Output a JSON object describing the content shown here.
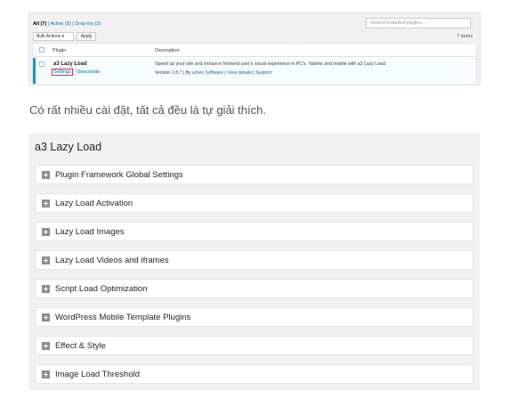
{
  "plugins_screen": {
    "filters": {
      "all": "All (7)",
      "sep1": " | ",
      "active": "Active (5)",
      "sep2": " | ",
      "dropins": "Drop-ins (2)"
    },
    "search_placeholder": "Search installed plugins...",
    "bulk_actions": "Bulk Actions ▾",
    "apply": "Apply",
    "items_count": "7 items",
    "columns": {
      "plugin": "Plugin",
      "description": "Description"
    },
    "row": {
      "name": "a3 Lazy Load",
      "settings": "Settings",
      "separator": " | ",
      "deactivate": "Deactivate",
      "description": "Speed up your site and enhance frontend user's visual experience in PC's, Tablets and mobile with a3 Lazy Load.",
      "version": "Version 1.8.7 | By ",
      "author": "a3rev Software",
      "sep": " | ",
      "view_details": "View details",
      "sep2": " | ",
      "support": "Support"
    }
  },
  "caption": "Có rất nhiều cài đặt, tất cả đều là tự giải thích.",
  "settings_screen": {
    "title": "a3 Lazy Load",
    "sections": [
      "Plugin Framework Global Settings",
      "Lazy Load Activation",
      "Lazy Load Images",
      "Lazy Load Videos and iframes",
      "Script Load Optimization",
      "WordPress Mobile Template Plugins",
      "Effect & Style",
      "Image Load Threshold"
    ]
  },
  "colors": {
    "accent_link": "#0073aa",
    "highlight_box": "#e03131",
    "active_border": "#00a0d2"
  }
}
